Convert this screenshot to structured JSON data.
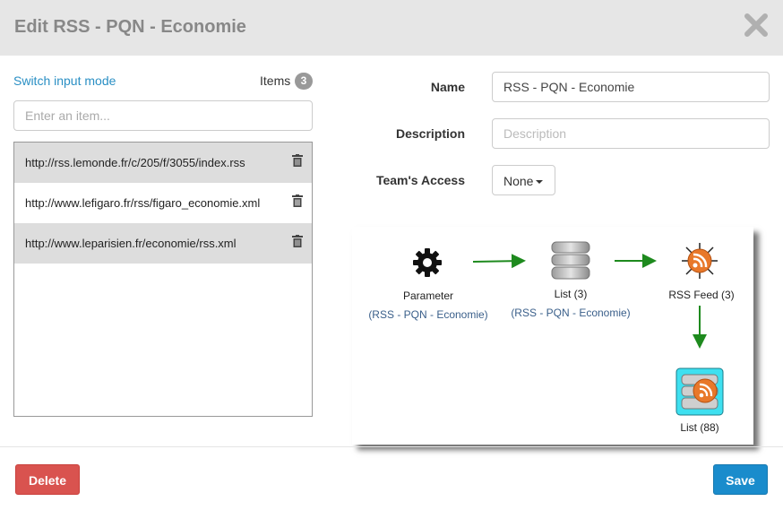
{
  "modal": {
    "title": "Edit RSS - PQN - Economie"
  },
  "items_panel": {
    "switch_link": "Switch input mode",
    "items_label": "Items",
    "items_count": "3",
    "input_placeholder": "Enter an item...",
    "items": [
      {
        "url": "http://rss.lemonde.fr/c/205/f/3055/index.rss",
        "icon": "trash-icon"
      },
      {
        "url": "http://www.lefigaro.fr/rss/figaro_economie.xml",
        "icon": "trash-icon"
      },
      {
        "url": "http://www.leparisien.fr/economie/rss.xml",
        "icon": "trash-icon"
      }
    ]
  },
  "form": {
    "name_label": "Name",
    "name_value": "RSS - PQN - Economie",
    "description_label": "Description",
    "description_placeholder": "Description",
    "team_label": "Team's Access",
    "team_value": "None"
  },
  "graph": {
    "nodes": [
      {
        "label": "Parameter",
        "sub": "(RSS - PQN - Economie)",
        "icon": "gear-icon"
      },
      {
        "label": "List (3)",
        "sub": "(RSS - PQN - Economie)",
        "icon": "database-icon"
      },
      {
        "label": "RSS Feed (3)",
        "sub": "",
        "icon": "rss-feed-icon"
      },
      {
        "label": "List (88)",
        "sub": "",
        "icon": "rss-database-icon"
      }
    ],
    "arrow_color": "#1e8a1e"
  },
  "footer": {
    "delete_label": "Delete",
    "save_label": "Save",
    "delete_color": "#d9534f",
    "save_color": "#1a8ccc"
  }
}
